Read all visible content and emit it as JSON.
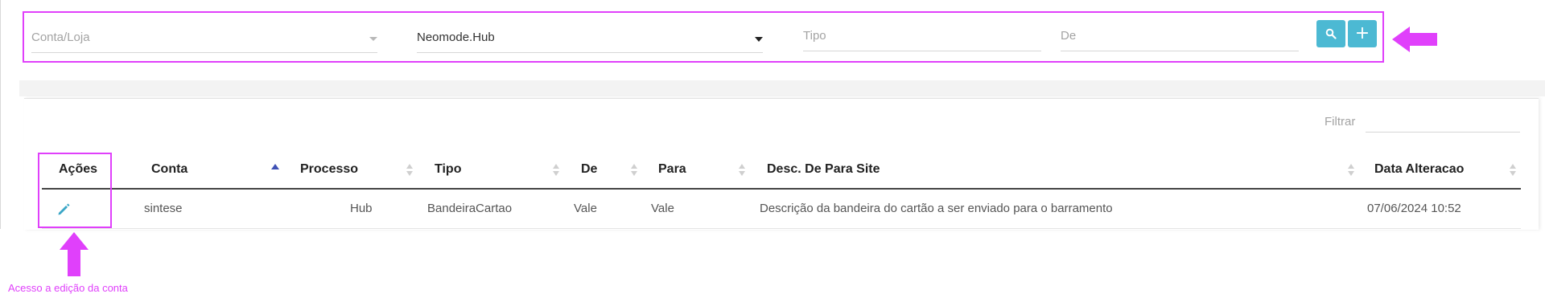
{
  "filters": {
    "conta_loja_placeholder": "Conta/Loja",
    "hub_value": "Neomode.Hub",
    "tipo_placeholder": "Tipo",
    "de_placeholder": "De",
    "search_icon": "search-icon",
    "add_label": "+"
  },
  "table": {
    "filter_label": "Filtrar",
    "columns": [
      "Ações",
      "Conta",
      "Processo",
      "Tipo",
      "De",
      "Para",
      "Desc. De Para Site",
      "Data Alteracao"
    ],
    "rows": [
      {
        "conta": "sintese",
        "processo": "Hub",
        "tipo": "BandeiraCartao",
        "de": "Vale",
        "para": "Vale",
        "desc": "Descrição da bandeira do cartão a ser enviado para o barramento",
        "data": "07/06/2024 10:52"
      }
    ]
  },
  "annotation": {
    "caption": "Acesso a edição da conta",
    "color": "#e040fb"
  },
  "colors": {
    "accent": "#4cb9d3",
    "sort_active": "#3f51b5"
  }
}
